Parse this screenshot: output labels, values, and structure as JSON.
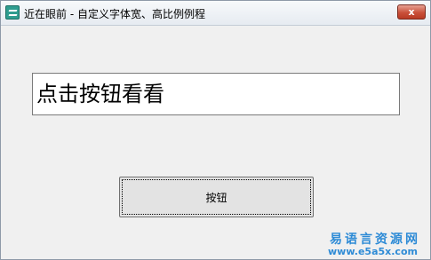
{
  "window": {
    "title": "近在眼前 - 自定义字体宽、高比例例程",
    "icon": "app-icon",
    "close_label": "x"
  },
  "main": {
    "display_text": "点击按钮看看",
    "button_label": "按钮"
  },
  "watermark": {
    "site_name": "易语言资源网",
    "url": "www.e5a5x.com"
  },
  "colors": {
    "window_bg": "#f0f0f0",
    "close_button": "#c9503a",
    "watermark": "#2e8bd6"
  }
}
